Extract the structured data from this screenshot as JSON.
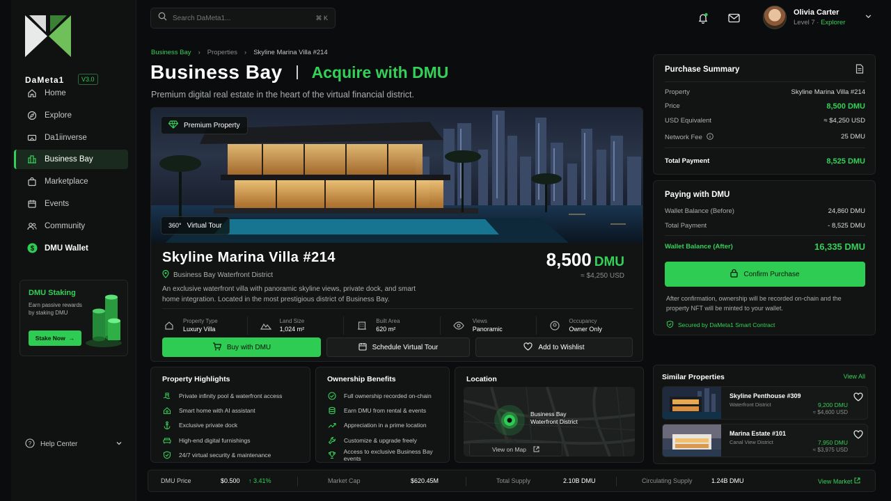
{
  "brand": {
    "name": "DaMeta1",
    "version": "V3.0"
  },
  "sidebar": {
    "items": [
      {
        "label": "Home",
        "icon": "home-icon"
      },
      {
        "label": "Explore",
        "icon": "compass-icon"
      },
      {
        "label": "Da1iinverse",
        "icon": "ticket-icon"
      },
      {
        "label": "Business Bay",
        "icon": "buildings-icon",
        "active": true
      },
      {
        "label": "Marketplace",
        "icon": "shopping-bag-icon"
      },
      {
        "label": "Events",
        "icon": "calendar-icon"
      },
      {
        "label": "Community",
        "icon": "users-icon"
      },
      {
        "label": "DMU Wallet",
        "icon": "dollar-icon"
      }
    ],
    "staking": {
      "title": "DMU Staking",
      "desc": "Earn passive rewards by staking DMU",
      "button": "Stake Now"
    },
    "help": "Help Center"
  },
  "topbar": {
    "search_placeholder": "Search DaMeta1...",
    "shortcut": "⌘ K",
    "user": {
      "name": "Olivia Carter",
      "level": "Level 7",
      "rank": "Explorer"
    }
  },
  "header": {
    "breadcrumbs": [
      "Business Bay",
      "Properties",
      "Skyline Marina Villa #214"
    ],
    "title": "Business Bay",
    "subtitle_accent": "Acquire with DMU",
    "tagline": "Premium digital real estate in the heart of the virtual financial district."
  },
  "property": {
    "badge": "Premium Property",
    "tour": "Virtual Tour",
    "tour_icon": "360°",
    "name": "Skyline Marina Villa #214",
    "location": "Business Bay Waterfront District",
    "description": "An exclusive waterfront villa with panoramic skyline views, private dock, and smart home integration. Located in the most prestigious district of Business Bay.",
    "price": "8,500",
    "price_unit": "DMU",
    "price_usd": "≈ $4,250 USD",
    "specs": [
      {
        "k": "Property Type",
        "v": "Luxury Villa"
      },
      {
        "k": "Land Size",
        "v": "1,024 m²"
      },
      {
        "k": "Built Area",
        "v": "620 m²"
      },
      {
        "k": "Views",
        "v": "Panoramic"
      },
      {
        "k": "Occupancy",
        "v": "Owner Only"
      }
    ],
    "actions": {
      "buy": "Buy with DMU",
      "schedule": "Schedule Virtual Tour",
      "wishlist": "Add to Wishlist"
    }
  },
  "highlights": {
    "title": "Property Highlights",
    "items": [
      "Private infinity pool & waterfront access",
      "Smart home with AI assistant",
      "Exclusive private dock",
      "High-end digital furnishings",
      "24/7 virtual security & maintenance"
    ]
  },
  "benefits": {
    "title": "Ownership Benefits",
    "items": [
      "Full ownership recorded on-chain",
      "Earn DMU from rental & events",
      "Appreciation in a prime location",
      "Customize & upgrade freely",
      "Access to exclusive Business Bay events"
    ]
  },
  "location": {
    "title": "Location",
    "label_line1": "Business Bay",
    "label_line2": "Waterfront District",
    "button": "View on Map"
  },
  "summary": {
    "title": "Purchase Summary",
    "rows": [
      {
        "k": "Property",
        "v": "Skyline Marina Villa #214"
      },
      {
        "k": "Price",
        "v": "8,500 DMU"
      },
      {
        "k": "USD Equivalent",
        "v": "≈ $4,250 USD"
      },
      {
        "k": "Network Fee",
        "v": "25 DMU"
      }
    ],
    "total_label": "Total Payment",
    "total_value": "8,525 DMU"
  },
  "paying": {
    "title": "Paying with DMU",
    "before_label": "Wallet Balance (Before)",
    "before_value": "24,860 DMU",
    "total_label": "Total Payment",
    "total_value": "- 8,525 DMU",
    "after_label": "Wallet Balance (After)",
    "after_value": "16,335 DMU",
    "confirm": "Confirm Purchase",
    "note": "After confirmation, ownership will be recorded on-chain and the property NFT will be minted to your wallet.",
    "secured": "Secured by DaMeta1 Smart Contract"
  },
  "similar": {
    "title": "Similar Properties",
    "view_all": "View All",
    "items": [
      {
        "name": "Skyline Penthouse #309",
        "district": "Waterfront District",
        "price": "9,200 DMU",
        "usd": "≈ $4,600 USD"
      },
      {
        "name": "Marina Estate #101",
        "district": "Canal View District",
        "price": "7,950 DMU",
        "usd": "≈ $3,975 USD"
      }
    ]
  },
  "stats": {
    "price_label": "DMU Price",
    "price": "$0.500",
    "change": "↑ 3.41%",
    "mcap_label": "Market Cap",
    "mcap": "$620.45M",
    "supply_label": "Total Supply",
    "supply": "2.10B DMU",
    "circ_label": "Circulating Supply",
    "circ": "1.24B DMU",
    "view_market": "View Market"
  },
  "colors": {
    "accent": "#2ecc52",
    "bg": "#0b0c0d",
    "panel": "#121413"
  }
}
